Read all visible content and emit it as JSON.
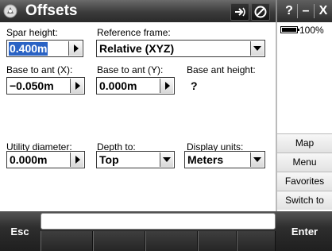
{
  "window": {
    "title": "Offsets",
    "controls": {
      "help": "?",
      "minimize": "–",
      "close": "X"
    }
  },
  "status": {
    "battery_percent": "100%"
  },
  "form": {
    "spar_height": {
      "label": "Spar height:",
      "value": "0.400m"
    },
    "reference_frame": {
      "label": "Reference frame:",
      "value": "Relative (XYZ)"
    },
    "base_to_ant_x": {
      "label": "Base to ant (X):",
      "value": "−0.050m"
    },
    "base_to_ant_y": {
      "label": "Base to ant (Y):",
      "value": "0.000m"
    },
    "base_ant_height": {
      "label": "Base ant height:",
      "value": "?"
    },
    "utility_diameter": {
      "label": "Utility diameter:",
      "value": "0.000m"
    },
    "depth_to": {
      "label": "Depth to:",
      "value": "Top"
    },
    "display_units": {
      "label": "Display units:",
      "value": "Meters"
    }
  },
  "side_menu": {
    "map": "Map",
    "menu": "Menu",
    "favorites": "Favorites",
    "switch_to": "Switch to"
  },
  "bottom": {
    "esc": "Esc",
    "enter": "Enter",
    "command_input": ""
  },
  "colors": {
    "selection": "#2b63c4",
    "titlebar": "#3b3b3b"
  }
}
